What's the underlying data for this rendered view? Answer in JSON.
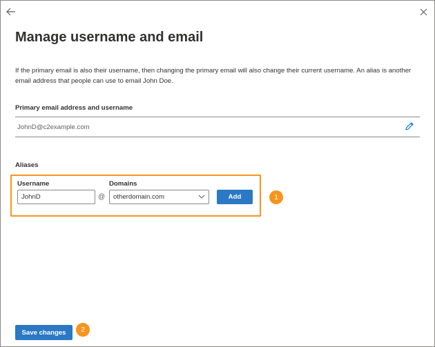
{
  "header": {
    "back_icon": "arrow-left-icon",
    "close_icon": "close-icon",
    "title": "Manage username and email",
    "description": "If the primary email is also their username, then changing the primary email will also change their current username. An alias is another email address that people can use to email John Doe."
  },
  "primary": {
    "label": "Primary email address and username",
    "value": "JohnD@c2example.com",
    "edit_icon": "pencil-icon"
  },
  "aliases": {
    "label": "Aliases",
    "username_label": "Username",
    "username_value": "JohnD",
    "at_symbol": "@",
    "domains_label": "Domains",
    "domains_selected": "otherdomain.com",
    "add_label": "Add",
    "highlight_color": "#f7941d"
  },
  "footer": {
    "save_label": "Save changes"
  },
  "callouts": {
    "one": "1",
    "two": "2",
    "color": "#f7941d"
  },
  "colors": {
    "primary_button": "#2b78c5",
    "link_icon": "#0078d4",
    "border": "#8a8886"
  }
}
